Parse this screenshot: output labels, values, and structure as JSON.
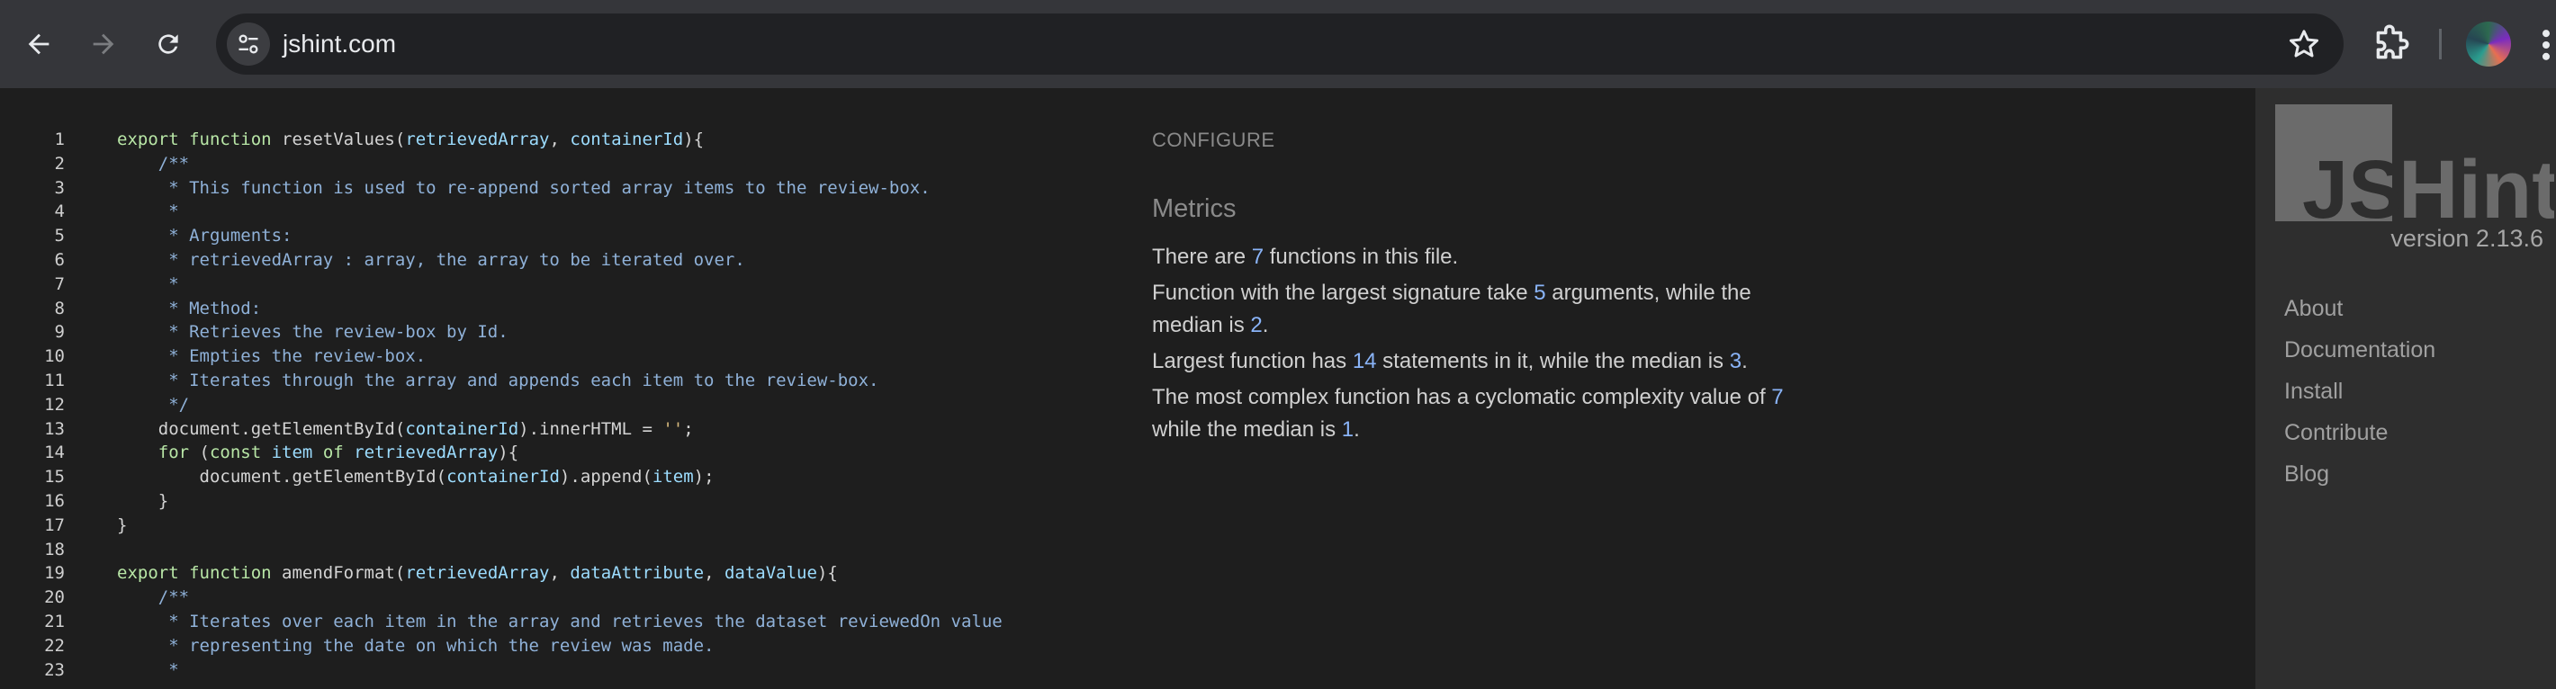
{
  "browser": {
    "url": "jshint.com"
  },
  "editor": {
    "lines": [
      {
        "n": "1",
        "tokens": [
          [
            "kw",
            "export "
          ],
          [
            "kw",
            "function "
          ],
          [
            "fn",
            "resetValues"
          ],
          [
            "",
            "("
          ],
          [
            "param",
            "retrievedArray"
          ],
          [
            "",
            ", "
          ],
          [
            "param",
            "containerId"
          ],
          [
            "",
            "){"
          ]
        ]
      },
      {
        "n": "2",
        "tokens": [
          [
            "cm",
            "    /**"
          ]
        ]
      },
      {
        "n": "3",
        "tokens": [
          [
            "cm",
            "     * This function is used to re-append sorted array items to the review-box."
          ]
        ]
      },
      {
        "n": "4",
        "tokens": [
          [
            "cm",
            "     *"
          ]
        ]
      },
      {
        "n": "5",
        "tokens": [
          [
            "cm",
            "     * Arguments:"
          ]
        ]
      },
      {
        "n": "6",
        "tokens": [
          [
            "cm",
            "     * retrievedArray : array, the array to be iterated over."
          ]
        ]
      },
      {
        "n": "7",
        "tokens": [
          [
            "cm",
            "     *"
          ]
        ]
      },
      {
        "n": "8",
        "tokens": [
          [
            "cm",
            "     * Method:"
          ]
        ]
      },
      {
        "n": "9",
        "tokens": [
          [
            "cm",
            "     * Retrieves the review-box by Id."
          ]
        ]
      },
      {
        "n": "10",
        "tokens": [
          [
            "cm",
            "     * Empties the review-box."
          ]
        ]
      },
      {
        "n": "11",
        "tokens": [
          [
            "cm",
            "     * Iterates through the array and appends each item to the review-box."
          ]
        ]
      },
      {
        "n": "12",
        "tokens": [
          [
            "cm",
            "     */"
          ]
        ]
      },
      {
        "n": "13",
        "tokens": [
          [
            "",
            "    document."
          ],
          [
            "fn",
            "getElementById"
          ],
          [
            "",
            "("
          ],
          [
            "param",
            "containerId"
          ],
          [
            "",
            ")."
          ],
          [
            "prop",
            "innerHTML"
          ],
          [
            "",
            " = "
          ],
          [
            "str",
            "''"
          ],
          [
            "",
            ";"
          ]
        ]
      },
      {
        "n": "14",
        "tokens": [
          [
            "kw",
            "    for "
          ],
          [
            "",
            "("
          ],
          [
            "kw",
            "const "
          ],
          [
            "param",
            "item "
          ],
          [
            "kw",
            "of "
          ],
          [
            "param",
            "retrievedArray"
          ],
          [
            "",
            "){"
          ]
        ]
      },
      {
        "n": "15",
        "tokens": [
          [
            "",
            "        document."
          ],
          [
            "fn",
            "getElementById"
          ],
          [
            "",
            "("
          ],
          [
            "param",
            "containerId"
          ],
          [
            "",
            ")."
          ],
          [
            "fn",
            "append"
          ],
          [
            "",
            "("
          ],
          [
            "param",
            "item"
          ],
          [
            "",
            ");"
          ]
        ]
      },
      {
        "n": "16",
        "tokens": [
          [
            "",
            "    }"
          ]
        ]
      },
      {
        "n": "17",
        "tokens": [
          [
            "",
            "}"
          ]
        ]
      },
      {
        "n": "18",
        "tokens": []
      },
      {
        "n": "19",
        "tokens": [
          [
            "kw",
            "export "
          ],
          [
            "kw",
            "function "
          ],
          [
            "fn",
            "amendFormat"
          ],
          [
            "",
            "("
          ],
          [
            "param",
            "retrievedArray"
          ],
          [
            "",
            ", "
          ],
          [
            "param",
            "dataAttribute"
          ],
          [
            "",
            ", "
          ],
          [
            "param",
            "dataValue"
          ],
          [
            "",
            "){"
          ]
        ]
      },
      {
        "n": "20",
        "tokens": [
          [
            "cm",
            "    /**"
          ]
        ]
      },
      {
        "n": "21",
        "tokens": [
          [
            "cm",
            "     * Iterates over each item in the array and retrieves the dataset reviewedOn value"
          ]
        ]
      },
      {
        "n": "22",
        "tokens": [
          [
            "cm",
            "     * representing the date on which the review was made."
          ]
        ]
      },
      {
        "n": "23",
        "tokens": [
          [
            "cm",
            "     *"
          ]
        ]
      }
    ]
  },
  "report": {
    "configure_label": "CONFIGURE",
    "metrics_title": "Metrics",
    "functions_count": "7",
    "largest_signature_args": "5",
    "median_args": "2",
    "largest_function_statements": "14",
    "median_statements": "3",
    "max_complexity": "7",
    "median_complexity": "1"
  },
  "sidebar": {
    "logo_js": "JS",
    "logo_hint": "Hint",
    "version": "version 2.13.6",
    "nav": [
      "About",
      "Documentation",
      "Install",
      "Contribute",
      "Blog"
    ]
  },
  "icons": {
    "back": "arrow-left-icon",
    "forward": "arrow-right-icon",
    "reload": "reload-icon",
    "site_info": "tune-icon",
    "bookmark": "star-icon",
    "extensions": "puzzle-icon",
    "profile": "avatar",
    "menu": "kebab-menu-icon"
  },
  "colors": {
    "chrome_bg": "#35363a",
    "editor_bg": "#1e1e1e",
    "sidebar_bg": "#2e2e2e",
    "accent_number": "#8ab4f8"
  }
}
